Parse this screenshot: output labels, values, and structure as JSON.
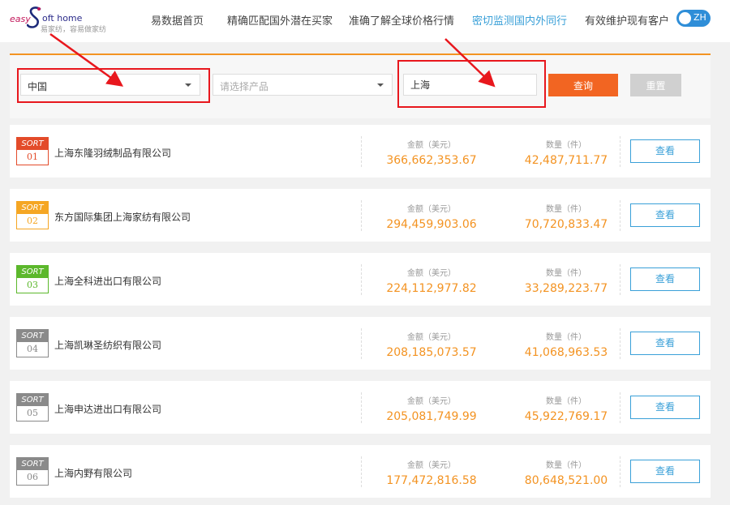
{
  "logo": {
    "prefix": "easy",
    "brand": "oft home",
    "tagline": "易家纺，容易做家纺"
  },
  "nav": {
    "items": [
      {
        "label": "易数据首页",
        "active": false
      },
      {
        "label": "精确匹配国外潜在买家",
        "active": false
      },
      {
        "label": "准确了解全球价格行情",
        "active": false
      },
      {
        "label": "密切监测国内外同行",
        "active": true
      },
      {
        "label": "有效维护现有客户",
        "active": false
      }
    ],
    "lang_label": "ZH"
  },
  "search": {
    "country_value": "中国",
    "product_placeholder": "请选择产品",
    "city_value": "上海",
    "query_label": "查询",
    "reset_label": "重置"
  },
  "colors": {
    "accent_orange": "#f39322",
    "query_orange": "#f26522",
    "link_blue": "#3aa0d8",
    "annotation_red": "#e8171d"
  },
  "results": {
    "sort_label": "SORT",
    "amount_label": "金额（美元）",
    "quantity_label": "数量（件）",
    "view_label": "查看",
    "rows": [
      {
        "rank": "01",
        "company": "上海东隆羽绒制品有限公司",
        "amount": "366,662,353.67",
        "quantity": "42,487,711.77",
        "badge_color": "#e34b2a"
      },
      {
        "rank": "02",
        "company": "东方国际集团上海家纺有限公司",
        "amount": "294,459,903.06",
        "quantity": "70,720,833.47",
        "badge_color": "#f5a623"
      },
      {
        "rank": "03",
        "company": "上海全科进出口有限公司",
        "amount": "224,112,977.82",
        "quantity": "33,289,223.77",
        "badge_color": "#5cb82c"
      },
      {
        "rank": "04",
        "company": "上海凯琳圣纺织有限公司",
        "amount": "208,185,073.57",
        "quantity": "41,068,963.53",
        "badge_color": "#8a8a8a"
      },
      {
        "rank": "05",
        "company": "上海申达进出口有限公司",
        "amount": "205,081,749.99",
        "quantity": "45,922,769.17",
        "badge_color": "#8a8a8a"
      },
      {
        "rank": "06",
        "company": "上海内野有限公司",
        "amount": "177,472,816.58",
        "quantity": "80,648,521.00",
        "badge_color": "#8a8a8a"
      }
    ]
  }
}
